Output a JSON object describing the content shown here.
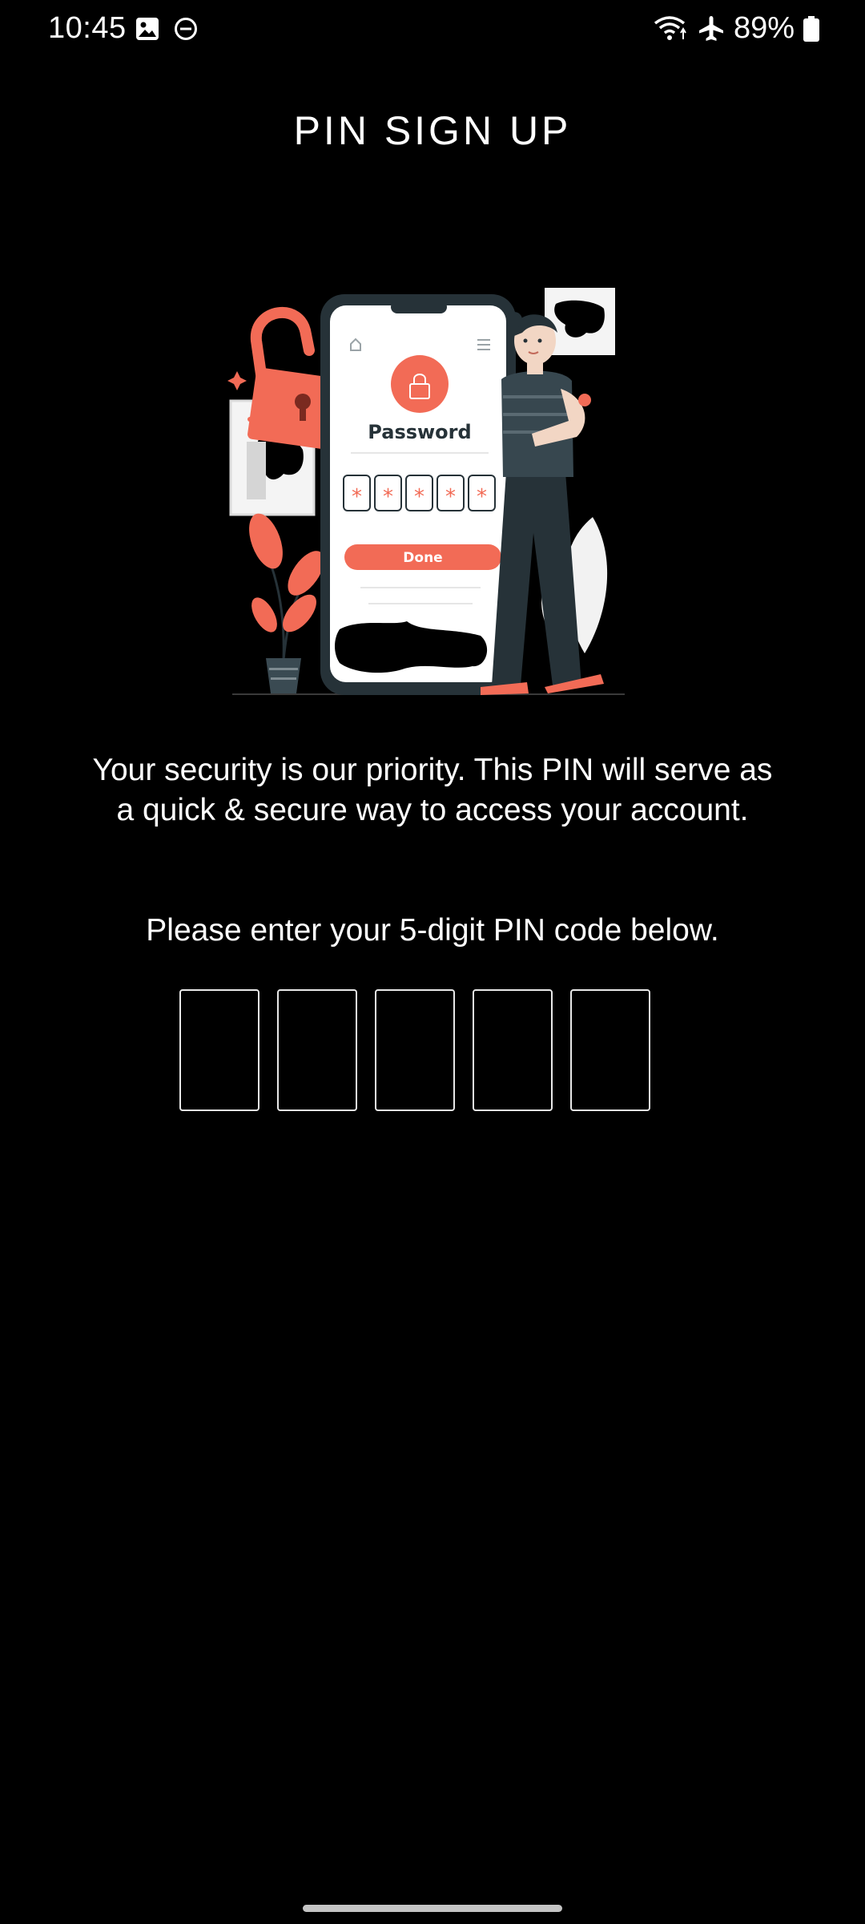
{
  "status_bar": {
    "time": "10:45",
    "battery": "89%",
    "icons": [
      "image-icon",
      "do-not-disturb-icon",
      "wifi-icon",
      "airplane-icon",
      "battery-icon"
    ]
  },
  "header": {
    "title": "PIN SIGN UP"
  },
  "illustration": {
    "password_label": "Password",
    "done_label": "Done",
    "accent_color": "#f26b56",
    "dark_color": "#263238"
  },
  "content": {
    "security_message": "Your security is our priority. This PIN will serve as a quick & secure way to access your account.",
    "instruction": "Please enter your 5-digit PIN code below."
  },
  "pin": {
    "length": 5,
    "digits": [
      "",
      "",
      "",
      "",
      ""
    ]
  },
  "colors": {
    "background": "#000000",
    "text": "#ffffff",
    "box_border": "#e8e8e8"
  }
}
